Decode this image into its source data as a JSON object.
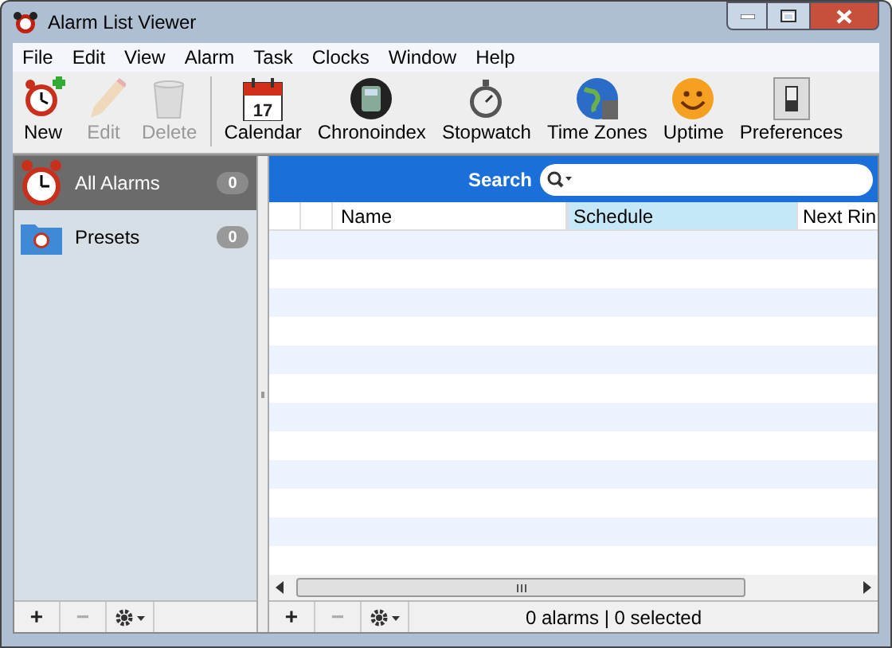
{
  "window": {
    "title": "Alarm List Viewer"
  },
  "menu": [
    "File",
    "Edit",
    "View",
    "Alarm",
    "Task",
    "Clocks",
    "Window",
    "Help"
  ],
  "toolbar": [
    {
      "label": "New",
      "kind": "new",
      "disabled": false
    },
    {
      "label": "Edit",
      "kind": "edit",
      "disabled": true
    },
    {
      "label": "Delete",
      "kind": "delete",
      "disabled": true
    },
    {
      "label": "Calendar",
      "kind": "calendar",
      "disabled": false,
      "icon_text": "17"
    },
    {
      "label": "Chronoindex",
      "kind": "chrono",
      "disabled": false
    },
    {
      "label": "Stopwatch",
      "kind": "stopwatch",
      "disabled": false
    },
    {
      "label": "Time Zones",
      "kind": "globe",
      "disabled": false
    },
    {
      "label": "Uptime",
      "kind": "smiley",
      "disabled": false
    },
    {
      "label": "Preferences",
      "kind": "switch",
      "disabled": false
    }
  ],
  "sidebar": {
    "items": [
      {
        "label": "All Alarms",
        "count": "0",
        "kind": "alarm",
        "selected": true
      },
      {
        "label": "Presets",
        "count": "0",
        "kind": "folder",
        "selected": false
      }
    ],
    "bottom_bar": [
      {
        "label": "+",
        "disabled": false
      },
      {
        "label": "−",
        "disabled": true
      }
    ]
  },
  "search": {
    "label": "Search"
  },
  "table": {
    "columns": [
      {
        "label": "Name",
        "selected": false
      },
      {
        "label": "Schedule",
        "selected": true
      },
      {
        "label": "Next Rin",
        "selected": false
      }
    ]
  },
  "bottom_bar": {
    "buttons": [
      {
        "label": "+",
        "disabled": false
      },
      {
        "label": "−",
        "disabled": true
      }
    ],
    "status": "0 alarms | 0 selected"
  }
}
